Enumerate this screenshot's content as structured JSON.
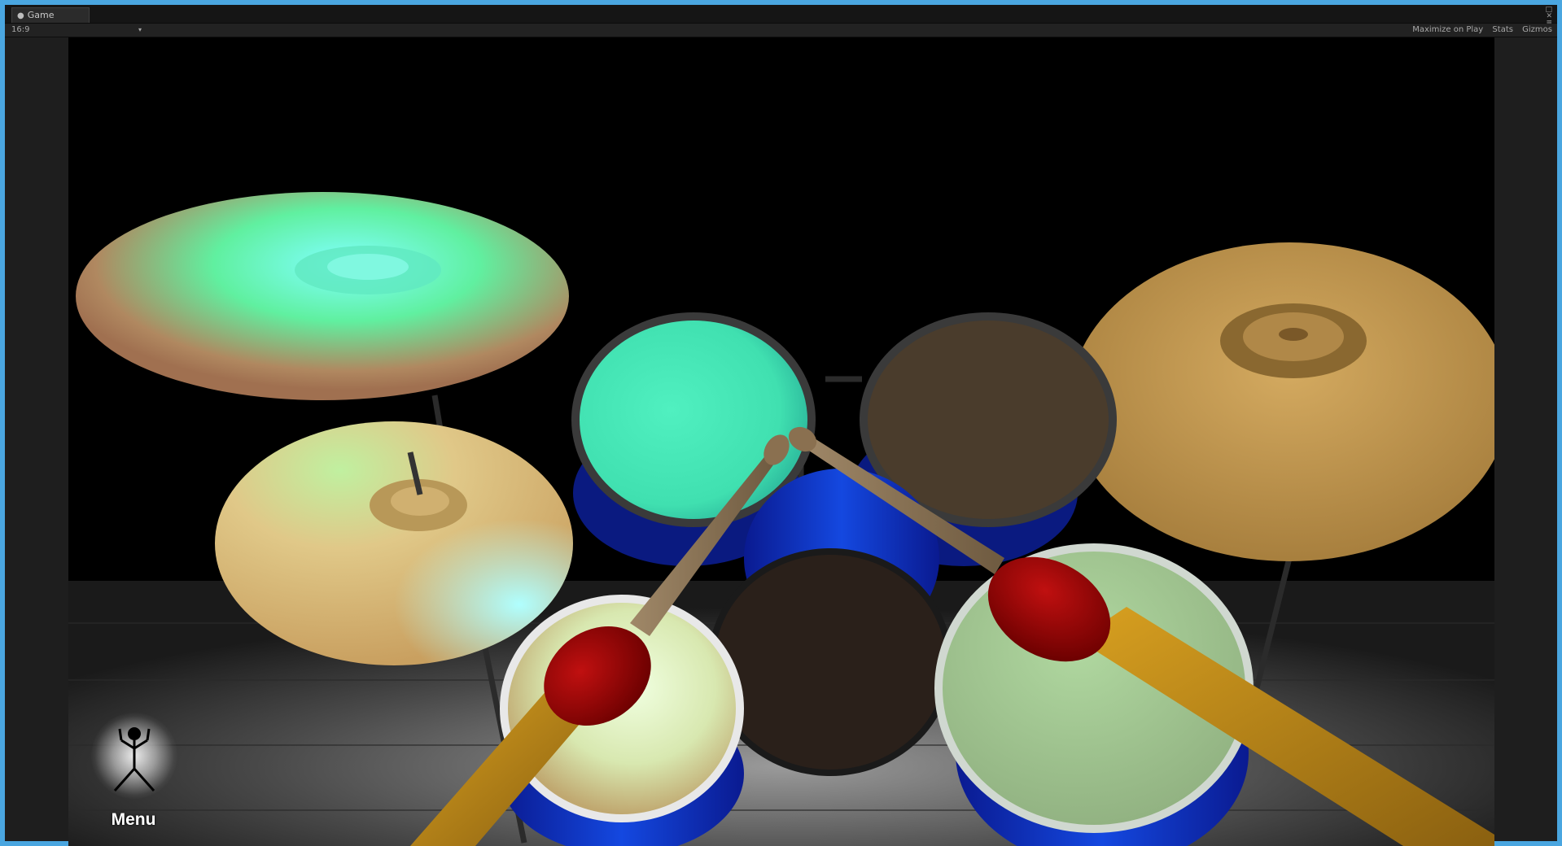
{
  "window": {
    "tab_label": "Game",
    "tab_icon": "game-controller-icon"
  },
  "toolbar": {
    "aspect_value": "16:9",
    "maximize_on_play_label": "Maximize on Play",
    "stats_label": "Stats",
    "gizmos_label": "Gizmos"
  },
  "scene": {
    "menu_label": "Menu",
    "menu_icon": "stick-figure-icon",
    "colors": {
      "frame_border": "#4aa6e0",
      "drum_shell_blue": "#1030c8",
      "stick_tip_red": "#8b0000",
      "stick_wood": "#b8860b",
      "cymbal_gold": "#c9a050",
      "highlight_cyan": "#60f0c0"
    }
  }
}
